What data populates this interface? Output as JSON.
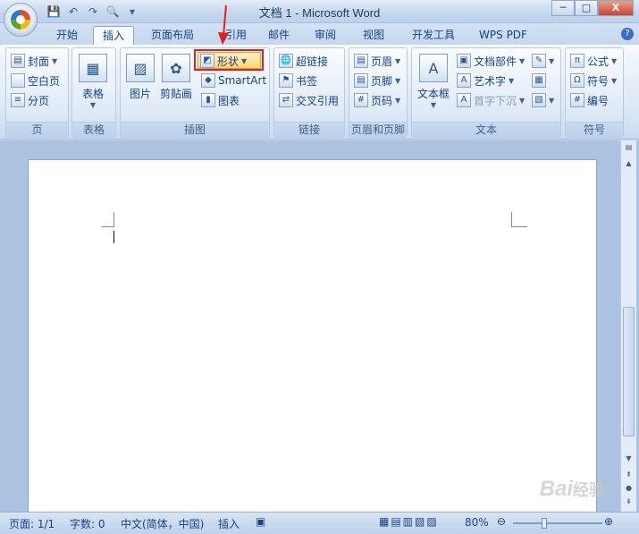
{
  "window": {
    "title": "文档 1 - Microsoft Word",
    "min": "─",
    "max": "□",
    "close": "X"
  },
  "qat": {
    "save": "💾",
    "undo": "↶",
    "redo": "↷",
    "print_preview": "🔍",
    "more": "▾"
  },
  "tabs": [
    "开始",
    "插入",
    "页面布局",
    "引用",
    "邮件",
    "审阅",
    "视图",
    "开发工具",
    "WPS PDF"
  ],
  "active_tab": "插入",
  "help": "?",
  "groups": {
    "page": {
      "label": "页",
      "items": [
        "封面",
        "空白页",
        "分页"
      ]
    },
    "table": {
      "label": "表格",
      "button": "表格"
    },
    "illustrations": {
      "label": "插图",
      "picture": "图片",
      "clipart": "剪贴画",
      "shapes": "形状",
      "smartart": "SmartArt",
      "chart": "图表"
    },
    "links": {
      "label": "链接",
      "items": [
        "超链接",
        "书签",
        "交叉引用"
      ]
    },
    "header_footer": {
      "label": "页眉和页脚",
      "items": [
        "页眉",
        "页脚",
        "页码"
      ]
    },
    "text": {
      "label": "文本",
      "textbox": "文本框",
      "items": [
        "文档部件",
        "艺术字",
        "首字下沉"
      ]
    },
    "symbols": {
      "label": "符号",
      "items": [
        "公式",
        "符号",
        "编号"
      ]
    }
  },
  "status": {
    "page": "页面: 1/1",
    "words": "字数: 0",
    "language": "中文(简体，中国)",
    "mode": "插入",
    "zoom": "80%"
  },
  "watermark": {
    "text": "Bai",
    "suffix": "经验"
  },
  "accent_colors": {
    "highlight": "#e02020",
    "ribbon": "#dbe7f6"
  }
}
